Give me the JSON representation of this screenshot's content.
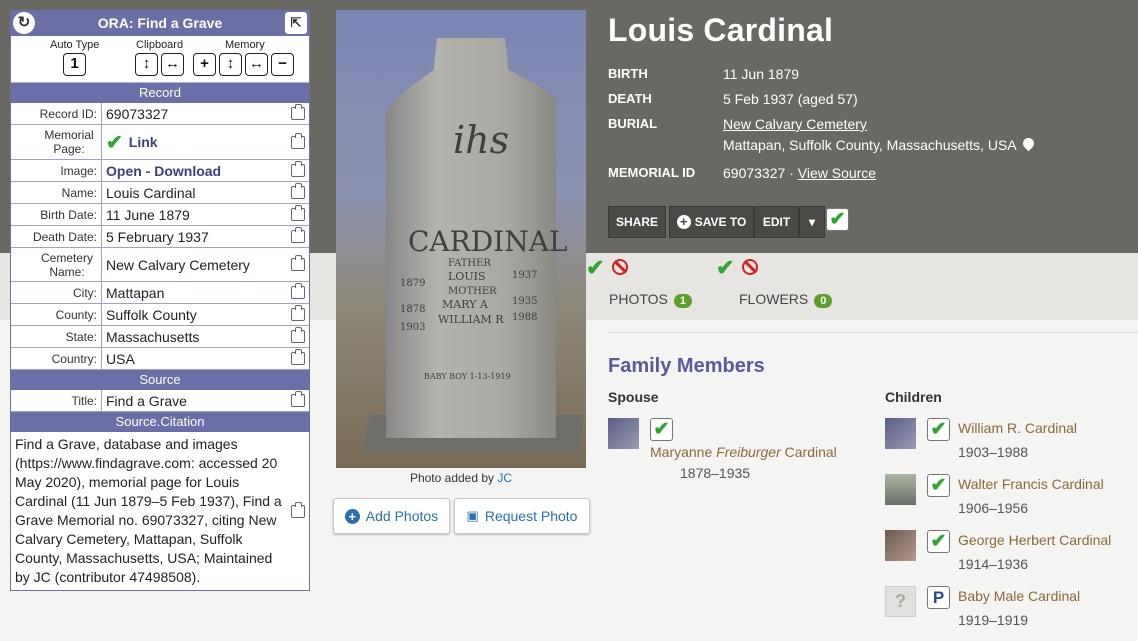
{
  "ora": {
    "title": "ORA: Find a Grave",
    "tools": {
      "auto_type_label": "Auto Type",
      "auto_type_value": "1",
      "clipboard_label": "Clipboard",
      "memory_label": "Memory"
    },
    "sections": {
      "record": "Record",
      "source": "Source",
      "citation": "Source.Citation"
    },
    "fields": [
      {
        "label": "Record ID:",
        "value": "69073327"
      },
      {
        "label": "Memorial Page:",
        "value": "Link"
      },
      {
        "label": "Image:",
        "value": "Open - Download"
      },
      {
        "label": "Name:",
        "value": "Louis Cardinal"
      },
      {
        "label": "Birth Date:",
        "value": "11 June 1879"
      },
      {
        "label": "Death Date:",
        "value": "5 February 1937"
      },
      {
        "label": "Cemetery Name:",
        "value": "New Calvary Cemetery"
      },
      {
        "label": "City:",
        "value": "Mattapan"
      },
      {
        "label": "County:",
        "value": "Suffolk County"
      },
      {
        "label": "State:",
        "value": "Massachusetts"
      },
      {
        "label": "Country:",
        "value": "USA"
      }
    ],
    "source_title_label": "Title:",
    "source_title_value": "Find a Grave",
    "citation_text": "Find a Grave, database and images (https://www.findagrave.com: accessed 20 May 2020), memorial page for Louis Cardinal (11 Jun 1879–5 Feb 1937), Find a Grave Memorial no. 69073327, citing New Calvary Cemetery, Mattapan, Suffolk County, Massachusetts, USA; Maintained by JC (contributor 47498508)."
  },
  "photo": {
    "stone_text": {
      "monogram": "ihs",
      "surname": "CARDINAL",
      "father": "FATHER",
      "louis": "LOUIS",
      "mother": "MOTHER",
      "mary": "MARY A",
      "william": "WILLIAM R",
      "y1": "1879",
      "y2": "1937",
      "y3": "1878",
      "y4": "1935",
      "y5": "1903",
      "y6": "1988",
      "baby": "BABY BOY 1-13-1919"
    },
    "caption_prefix": "Photo added by",
    "caption_author": "JC",
    "add_photos": "Add Photos",
    "request_photo": "Request Photo"
  },
  "memorial": {
    "name": "Louis Cardinal",
    "birth_label": "BIRTH",
    "birth_value": "11 Jun 1879",
    "death_label": "DEATH",
    "death_value": "5 Feb 1937 (aged 57)",
    "burial_label": "BURIAL",
    "burial_cemetery": "New Calvary Cemetery",
    "burial_place": "Mattapan, Suffolk County, Massachusetts, USA",
    "memorial_id_label": "MEMORIAL ID",
    "memorial_id_value": "69073327",
    "memorial_id_sep": "·",
    "view_source": "View Source",
    "actions": {
      "share": "SHARE",
      "save_to": "SAVE TO",
      "edit": "EDIT",
      "dropdown": "▾"
    }
  },
  "tabs": [
    {
      "label": "PHOTOS",
      "count": "1"
    },
    {
      "label": "FLOWERS",
      "count": "0"
    }
  ],
  "family": {
    "title": "Family Members",
    "spouse_label": "Spouse",
    "children_label": "Children",
    "spouse": {
      "first": "Maryanne",
      "maiden": "Freiburger",
      "last": "Cardinal",
      "dates": "1878–1935"
    },
    "children": [
      {
        "name": "William R. Cardinal",
        "dates": "1903–1988"
      },
      {
        "name": "Walter Francis Cardinal",
        "dates": "1906–1956"
      },
      {
        "name": "George Herbert Cardinal",
        "dates": "1914–1936"
      },
      {
        "name": "Baby Male Cardinal",
        "dates": "1919–1919"
      }
    ]
  },
  "colors": {
    "panel_accent": "#6b6fa8",
    "hero_bg": "#6a6863",
    "link_blue": "#2a6fae",
    "person_link": "#8a6a3a",
    "badge_green": "#5d9f2a",
    "check_green": "#2fa52f",
    "no_red": "#d32020"
  },
  "icons": [
    "refresh-icon",
    "expand-icon",
    "clipboard-icon",
    "check-icon",
    "prohibited-icon",
    "map-pin-icon",
    "plus-circle-icon",
    "camera-icon",
    "p-icon"
  ]
}
